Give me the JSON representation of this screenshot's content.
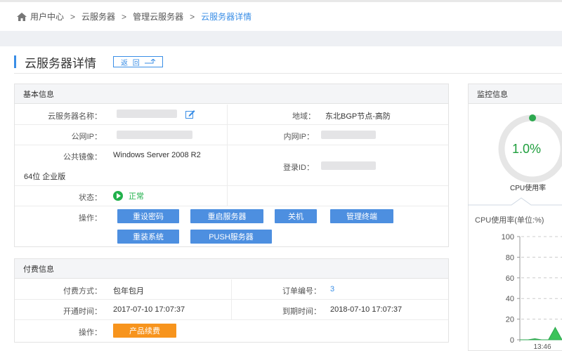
{
  "breadcrumb": {
    "items": [
      "用户中心",
      "云服务器",
      "管理云服务器",
      "云服务器详情"
    ],
    "separator": ">"
  },
  "page": {
    "title": "云服务器详情",
    "back_label": "返 回"
  },
  "basic_info": {
    "header": "基本信息",
    "name_label": "云服务器名称：",
    "region_label": "地域：",
    "region_value": "东北BGP节点-高防",
    "public_ip_label": "公网IP：",
    "private_ip_label": "内网IP：",
    "image_label": "公共镜像：",
    "image_value_line1": "Windows Server 2008 R2",
    "image_value_line2": "64位 企业版",
    "login_id_label": "登录ID：",
    "status_label": "状态：",
    "status_value": "正常",
    "ops_label": "操作：",
    "buttons": [
      "重设密码",
      "重启服务器",
      "关机",
      "管理终端",
      "重装系统",
      "PUSH服务器"
    ]
  },
  "billing": {
    "header": "付费信息",
    "pay_type_label": "付费方式：",
    "pay_type_value": "包年包月",
    "order_label": "订单编号：",
    "order_value": "3",
    "open_time_label": "开通时间：",
    "open_time_value": "2017-07-10 17:07:37",
    "expire_label": "到期时间：",
    "expire_value": "2018-07-10 17:07:37",
    "ops_label": "操作：",
    "renew_button": "产品续费"
  },
  "monitor": {
    "header": "监控信息",
    "cpu_value": "1.0%",
    "cpu_label": "CPU使用率",
    "chart_title": "CPU使用率(单位:%)"
  },
  "colors": {
    "accent": "#3a8ee6",
    "button": "#4d8fe0",
    "orange": "#f7941d",
    "green": "#22b14c"
  },
  "chart_data": {
    "type": "area",
    "title": "CPU使用率(单位:%)",
    "ylim": [
      0,
      100
    ],
    "yticks": [
      "100",
      "80",
      "60",
      "40",
      "20",
      "0"
    ],
    "x": [
      "13:46"
    ],
    "series": [
      {
        "values": [
          0,
          0,
          1,
          0,
          0,
          12,
          0
        ]
      }
    ]
  }
}
